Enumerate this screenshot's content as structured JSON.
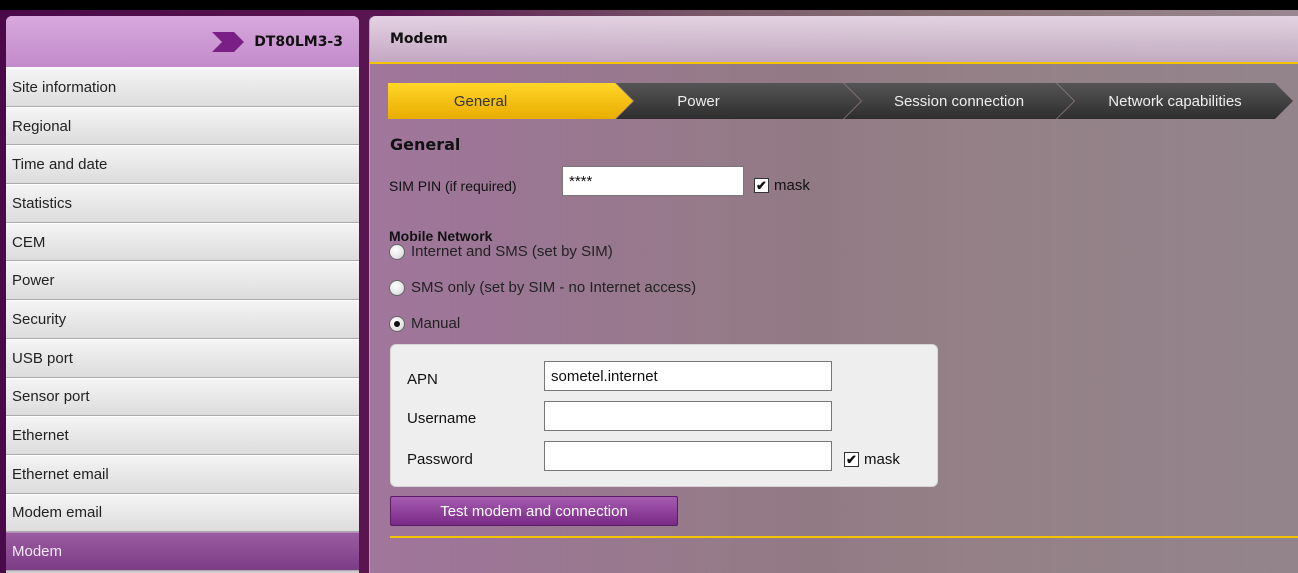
{
  "header": {
    "device_name": "DT80LM3-3",
    "logo_icon": "chevron-logo-icon"
  },
  "sidebar": {
    "items": [
      {
        "label": "Site information"
      },
      {
        "label": "Regional"
      },
      {
        "label": "Time and date"
      },
      {
        "label": "Statistics"
      },
      {
        "label": "CEM"
      },
      {
        "label": "Power"
      },
      {
        "label": "Security"
      },
      {
        "label": "USB port"
      },
      {
        "label": "Sensor port"
      },
      {
        "label": "Ethernet"
      },
      {
        "label": "Ethernet email"
      },
      {
        "label": "Modem email"
      },
      {
        "label": "Modem",
        "active": true
      }
    ]
  },
  "main": {
    "title": "Modem",
    "tabs": [
      {
        "label": "General",
        "active": true
      },
      {
        "label": "Power"
      },
      {
        "label": "Session connection"
      },
      {
        "label": "Network capabilities"
      }
    ],
    "section_heading": "General",
    "sim_pin": {
      "label": "SIM PIN  (if required)",
      "value": "****",
      "mask_label": "mask",
      "mask_checked": true
    },
    "mobile_network": {
      "heading": "Mobile Network",
      "options": [
        {
          "label": "Internet and SMS  (set by SIM)",
          "checked": false
        },
        {
          "label": "SMS only  (set by SIM - no Internet access)",
          "checked": false
        },
        {
          "label": "Manual",
          "checked": true
        }
      ]
    },
    "manual": {
      "apn": {
        "label": "APN",
        "value": "sometel.internet"
      },
      "username": {
        "label": "Username",
        "value": ""
      },
      "password": {
        "label": "Password",
        "value": "",
        "mask_label": "mask",
        "mask_checked": true
      }
    },
    "test_button": "Test modem and connection"
  },
  "colors": {
    "accent_yellow": "#f5c400",
    "active_purple": "#7d3d86",
    "button_purple": "#8b3a98"
  }
}
